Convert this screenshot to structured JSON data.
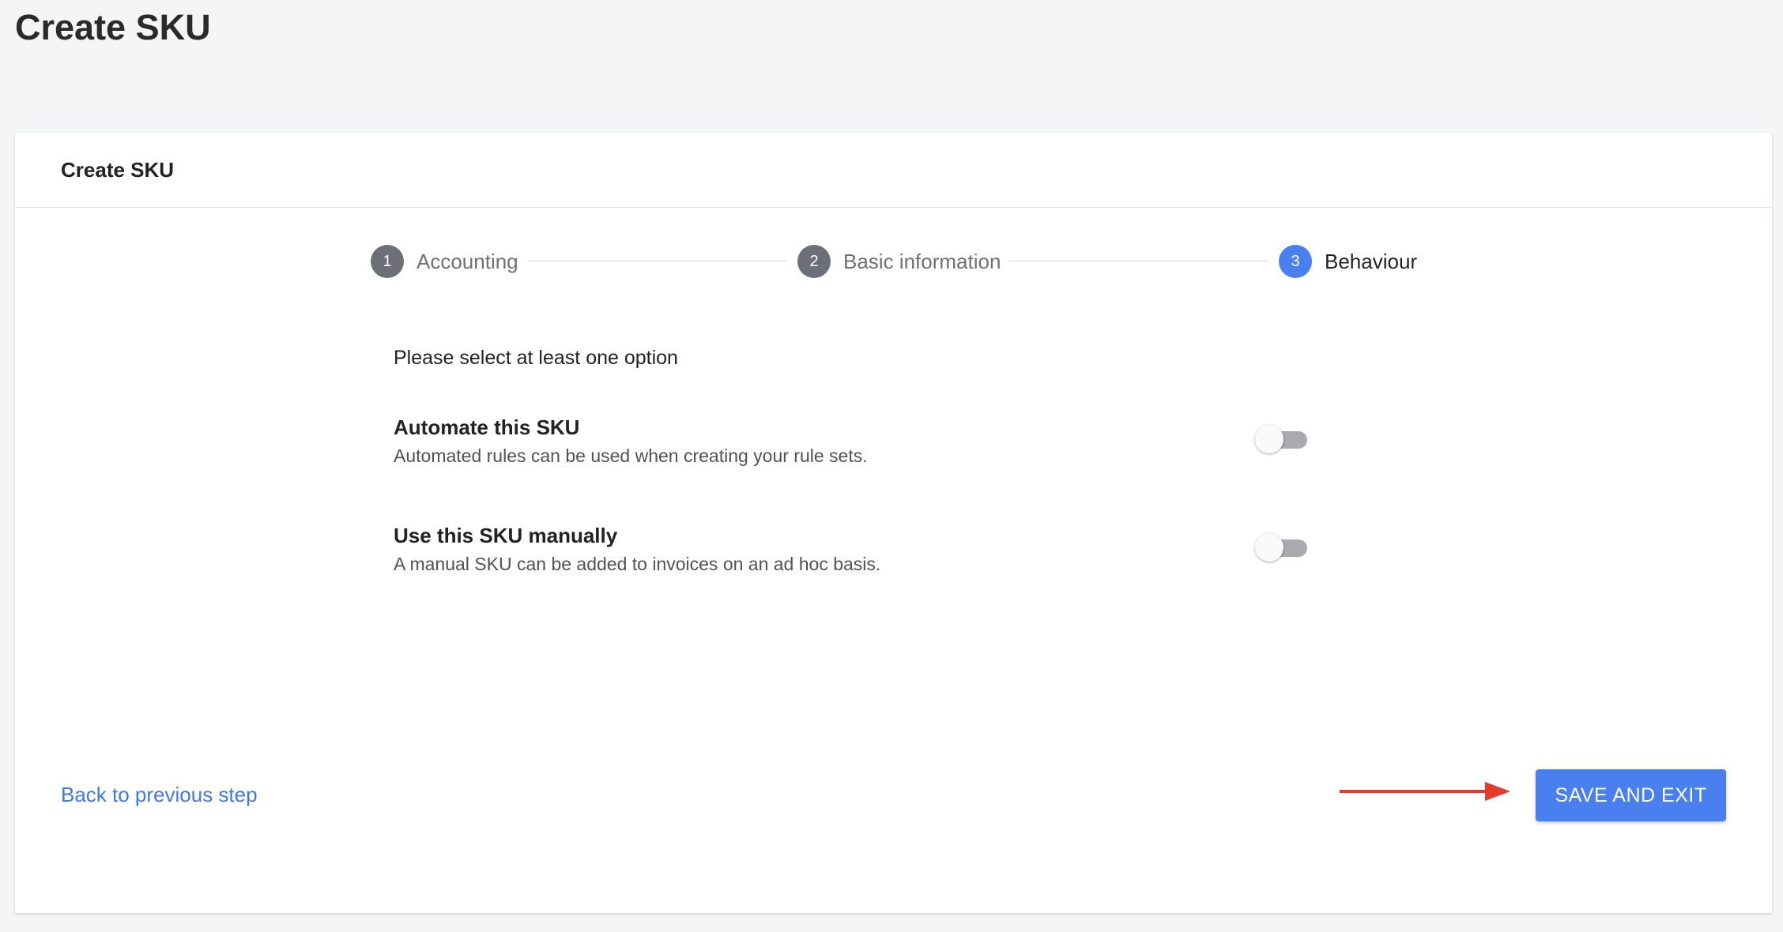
{
  "page": {
    "title": "Create SKU"
  },
  "card": {
    "title": "Create SKU"
  },
  "stepper": {
    "steps": [
      {
        "number": "1",
        "label": "Accounting",
        "active": false
      },
      {
        "number": "2",
        "label": "Basic information",
        "active": false
      },
      {
        "number": "3",
        "label": "Behaviour",
        "active": true
      }
    ]
  },
  "form": {
    "intro": "Please select at least one option",
    "options": [
      {
        "title": "Automate this SKU",
        "description": "Automated rules can be used when creating your rule sets.",
        "enabled": false
      },
      {
        "title": "Use this SKU manually",
        "description": "A manual SKU can be added to invoices on an ad hoc basis.",
        "enabled": false
      }
    ]
  },
  "footer": {
    "back_label": "Back to previous step",
    "save_label": "SAVE AND EXIT"
  },
  "colors": {
    "accent": "#4a7fef",
    "step_inactive": "#6c6f77",
    "annotation_arrow": "#e53b2c",
    "link": "#3f78e8"
  },
  "icons": {
    "annotation": "arrow-right-icon"
  }
}
